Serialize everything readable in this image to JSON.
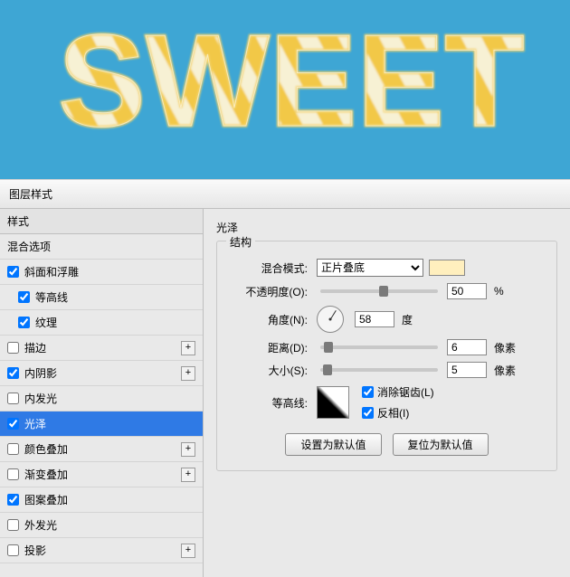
{
  "preview": {
    "text": "SWEET"
  },
  "dialog": {
    "title": "图层样式"
  },
  "sidebar": {
    "styles_header": "样式",
    "blend_options": "混合选项",
    "items": [
      {
        "label": "斜面和浮雕",
        "checked": true,
        "plus": false,
        "indent": false
      },
      {
        "label": "等高线",
        "checked": true,
        "plus": false,
        "indent": true
      },
      {
        "label": "纹理",
        "checked": true,
        "plus": false,
        "indent": true
      },
      {
        "label": "描边",
        "checked": false,
        "plus": true,
        "indent": false
      },
      {
        "label": "内阴影",
        "checked": true,
        "plus": true,
        "indent": false
      },
      {
        "label": "内发光",
        "checked": false,
        "plus": false,
        "indent": false
      },
      {
        "label": "光泽",
        "checked": true,
        "plus": false,
        "indent": false,
        "selected": true
      },
      {
        "label": "颜色叠加",
        "checked": false,
        "plus": true,
        "indent": false
      },
      {
        "label": "渐变叠加",
        "checked": false,
        "plus": true,
        "indent": false
      },
      {
        "label": "图案叠加",
        "checked": true,
        "plus": false,
        "indent": false
      },
      {
        "label": "外发光",
        "checked": false,
        "plus": false,
        "indent": false
      },
      {
        "label": "投影",
        "checked": false,
        "plus": true,
        "indent": false
      }
    ]
  },
  "panel": {
    "title": "光泽",
    "structure_label": "结构",
    "blend_mode_label": "混合模式:",
    "blend_mode_value": "正片叠底",
    "swatch_color": "#ffefbe",
    "opacity_label": "不透明度(O):",
    "opacity_value": "50",
    "opacity_unit": "%",
    "angle_label": "角度(N):",
    "angle_value": "58",
    "angle_unit": "度",
    "distance_label": "距离(D):",
    "distance_value": "6",
    "distance_unit": "像素",
    "size_label": "大小(S):",
    "size_value": "5",
    "size_unit": "像素",
    "contour_label": "等高线:",
    "antialiased_label": "消除锯齿(L)",
    "antialiased": true,
    "invert_label": "反相(I)",
    "invert": true,
    "set_default": "设置为默认值",
    "reset_default": "复位为默认值"
  }
}
